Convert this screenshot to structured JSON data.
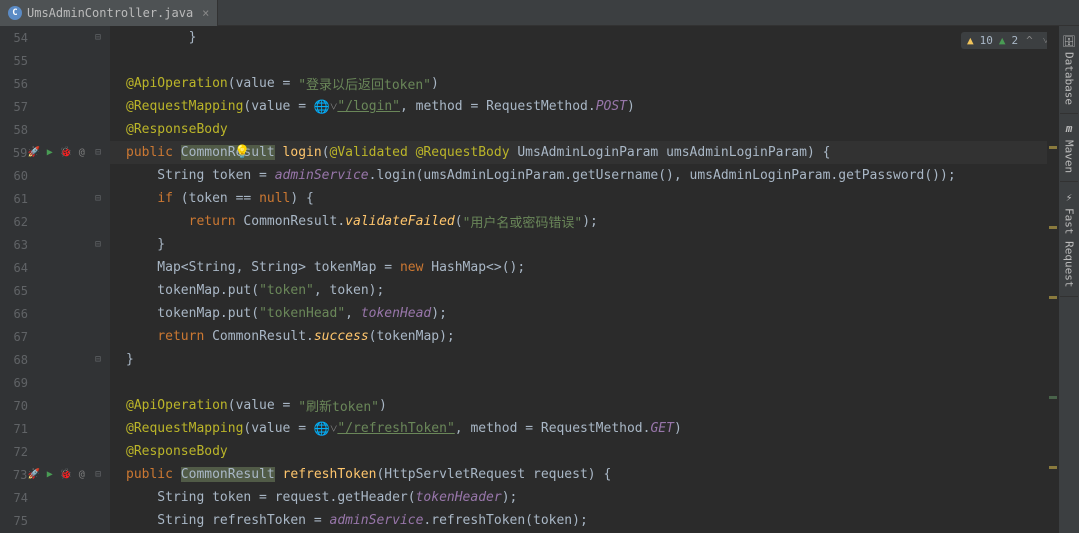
{
  "tab": {
    "title": "UmsAdminController.java",
    "icon_letter": "C"
  },
  "sidebar": {
    "items": [
      {
        "label": "Database"
      },
      {
        "label": "Maven"
      },
      {
        "label": "Fast Request"
      }
    ]
  },
  "inspections": {
    "warnings": "10",
    "hints": "2"
  },
  "code": {
    "l54": "        }",
    "l55": "",
    "l56_ann": "@ApiOperation",
    "l56_attr": "(value = ",
    "l56_str": "\"登录以后返回token\"",
    "l56_end": ")",
    "l57_ann": "@RequestMapping",
    "l57_attr": "(value = ",
    "l57_globe": "🌐˅",
    "l57_str": "\"/login\"",
    "l57_mid": ", method = RequestMethod.",
    "l57_em": "POST",
    "l57_end": ")",
    "l58_ann": "@ResponseBody",
    "l59_kw": "public ",
    "l59_cls": "CommonResult",
    "l59_fn": " login",
    "l59_p": "(",
    "l59_a1": "@Validated ",
    "l59_a2": "@RequestBody ",
    "l59_t": "UmsAdminLoginParam ",
    "l59_pn": "umsAdminLoginParam",
    "l59_end": ") {",
    "l60_a": "    String token = ",
    "l60_f": "adminService",
    "l60_b": ".login(umsAdminLoginParam.getUsername(), umsAdminLoginParam.getPassword());",
    "l61_a": "    ",
    "l61_kw": "if ",
    "l61_b": "(token == ",
    "l61_kw2": "null",
    "l61_c": ") {",
    "l62_a": "        ",
    "l62_kw": "return ",
    "l62_b": "CommonResult.",
    "l62_fn": "validateFailed",
    "l62_c": "(",
    "l62_s": "\"用户名或密码错误\"",
    "l62_d": ");",
    "l63": "    }",
    "l64_a": "    Map<String, String> tokenMap = ",
    "l64_kw": "new ",
    "l64_b": "HashMap<>();",
    "l65_a": "    tokenMap.put(",
    "l65_s": "\"token\"",
    "l65_b": ", token);",
    "l66_a": "    tokenMap.put(",
    "l66_s": "\"tokenHead\"",
    "l66_b": ", ",
    "l66_f": "tokenHead",
    "l66_c": ");",
    "l67_a": "    ",
    "l67_kw": "return ",
    "l67_b": "CommonResult.",
    "l67_fn": "success",
    "l67_c": "(tokenMap);",
    "l68": "}",
    "l69": "",
    "l70_ann": "@ApiOperation",
    "l70_attr": "(value = ",
    "l70_str": "\"刷新token\"",
    "l70_end": ")",
    "l71_ann": "@RequestMapping",
    "l71_attr": "(value = ",
    "l71_globe": "🌐˅",
    "l71_str": "\"/refreshToken\"",
    "l71_mid": ", method = RequestMethod.",
    "l71_em": "GET",
    "l71_end": ")",
    "l72_ann": "@ResponseBody",
    "l73_kw": "public ",
    "l73_cls": "CommonResult",
    "l73_fn": " refreshToken",
    "l73_a": "(HttpServletRequest request) {",
    "l74_a": "    String token = request.getHeader(",
    "l74_f": "tokenHeader",
    "l74_b": ");",
    "l75_a": "    String refreshToken = ",
    "l75_f": "adminService",
    "l75_b": ".refreshToken(token);"
  },
  "line_numbers": [
    "54",
    "55",
    "56",
    "57",
    "58",
    "59",
    "60",
    "61",
    "62",
    "63",
    "64",
    "65",
    "66",
    "67",
    "68",
    "69",
    "70",
    "71",
    "72",
    "73",
    "74",
    "75"
  ]
}
